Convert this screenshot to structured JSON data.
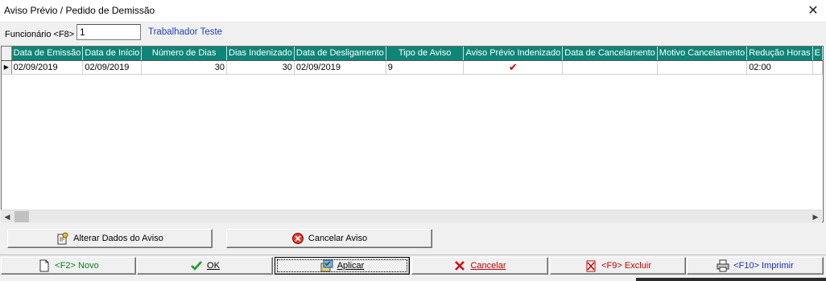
{
  "window": {
    "title": "Aviso Prévio / Pedido de Demissão",
    "close_glyph": "✕"
  },
  "employee": {
    "label": "Funcionário <F8>",
    "value": "1",
    "name": "Trabalhador Teste"
  },
  "grid": {
    "columns": [
      "Data de Emissão",
      "Data de Início",
      "Número de Dias",
      "Dias Indenizado",
      "Data de Desligamento",
      "Tipo de Aviso",
      "Aviso Prévio Indenizado",
      "Data de Cancelamento",
      "Motivo Cancelamento",
      "Redução Horas",
      "E"
    ],
    "rows": [
      {
        "indicator": "▶",
        "data_emissao": "02/09/2019",
        "data_inicio": "02/09/2019",
        "numero_dias": "30",
        "dias_indenizado": "30",
        "data_desligamento": "02/09/2019",
        "tipo_aviso": "9",
        "aviso_indenizado": "✔",
        "data_cancelamento": "",
        "motivo_cancelamento": "",
        "reducao_horas": "02:00"
      }
    ]
  },
  "actions": {
    "alterar": "Alterar Dados do Aviso",
    "cancelar_aviso": "Cancelar Aviso"
  },
  "bottom": {
    "novo": "<F2> Novo",
    "ok": "OK",
    "aplicar": "Aplicar",
    "cancelar": "Cancelar",
    "excluir": "<F9> Excluir",
    "imprimir": "<F10> Imprimir"
  },
  "icons": {
    "close": "close-icon",
    "alterar": "edit-notice-icon",
    "cancelar_aviso": "cancel-notice-icon",
    "novo": "new-document-icon",
    "ok": "check-icon",
    "aplicar": "apply-icon",
    "cancelar": "cancel-x-icon",
    "excluir": "delete-icon",
    "imprimir": "printer-icon"
  },
  "colors": {
    "header_bg": "#0f8578",
    "employee_name": "#1f3fb5",
    "check": "#cc0000",
    "novo": "#0a7a22",
    "danger": "#c00000",
    "imprimir": "#1a2fb0"
  }
}
